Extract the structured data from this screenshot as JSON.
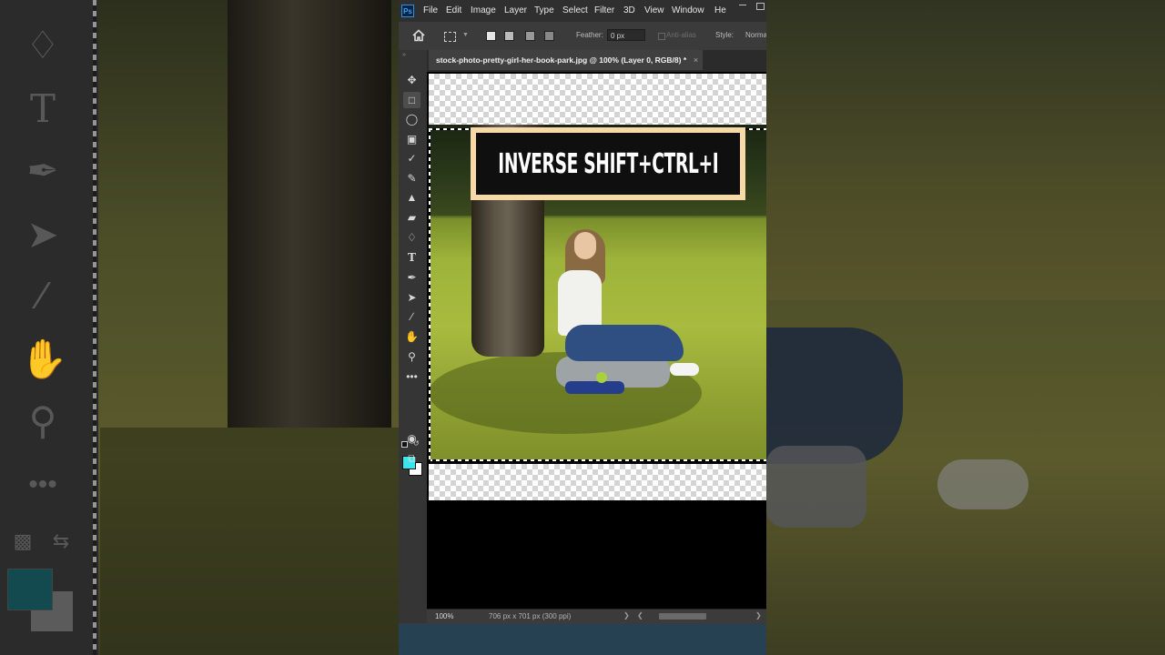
{
  "menu": {
    "app_logo": "Ps",
    "items": [
      "File",
      "Edit",
      "Image",
      "Layer",
      "Type",
      "Select",
      "Filter",
      "3D",
      "View",
      "Window",
      "He"
    ]
  },
  "options_bar": {
    "feather_label": "Feather:",
    "feather_value": "0 px",
    "antialias_label": "Anti-alias",
    "style_label": "Style:",
    "style_value": "Norma"
  },
  "document": {
    "tab_title": "stock-photo-pretty-girl-her-book-park.jpg @ 100% (Layer 0, RGB/8) *",
    "tab_close": "×"
  },
  "overlay": {
    "caption": "INVERSE SHIFT+CTRL+I"
  },
  "status": {
    "zoom": "100%",
    "doc_info": "706 px x 701 px (300 ppi)"
  },
  "colors": {
    "foreground": "#38e6ee",
    "background": "#ffffff",
    "overlay_border": "#f7d9a8"
  },
  "tools": [
    "move-icon",
    "rectangular-marquee-icon",
    "lasso-icon",
    "object-selection-icon",
    "eyedropper-icon",
    "brush-icon",
    "clone-stamp-icon",
    "eraser-icon",
    "paint-bucket-icon",
    "type-icon",
    "pen-icon",
    "path-selection-icon",
    "line-icon",
    "hand-icon",
    "zoom-icon",
    "more-tools-icon",
    "quick-mask-icon",
    "screen-mode-icon"
  ]
}
